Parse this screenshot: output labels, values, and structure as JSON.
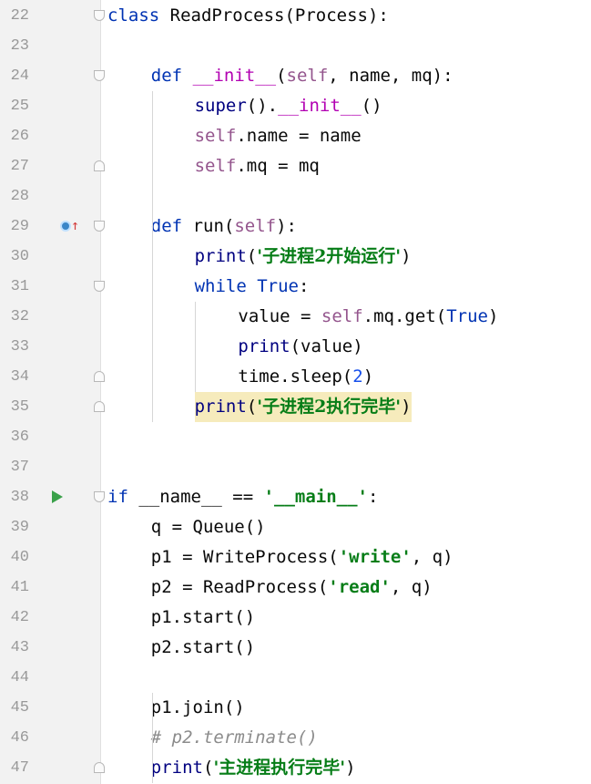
{
  "lines": [
    {
      "n": "22",
      "t": [
        [
          "kw",
          "class"
        ],
        [
          "",
          "ReadProcess(Process):"
        ]
      ]
    },
    {
      "n": "23",
      "t": []
    },
    {
      "n": "24",
      "t": [
        [
          "kw",
          "def"
        ],
        [
          "",
          ""
        ],
        [
          "dunder",
          "__init__"
        ],
        [
          "",
          "("
        ],
        [
          "self",
          "self"
        ],
        [
          "",
          ", name, mq):"
        ]
      ]
    },
    {
      "n": "25",
      "t": [
        [
          "fn",
          "super"
        ],
        [
          "",
          "()."
        ],
        [
          "dunder",
          "__init__"
        ],
        [
          "",
          "()"
        ]
      ]
    },
    {
      "n": "26",
      "t": [
        [
          "self",
          "self"
        ],
        [
          "",
          ".name = name"
        ]
      ]
    },
    {
      "n": "27",
      "t": [
        [
          "self",
          "self"
        ],
        [
          "",
          ".mq = mq"
        ]
      ]
    },
    {
      "n": "28",
      "t": []
    },
    {
      "n": "29",
      "t": [
        [
          "kw",
          "def"
        ],
        [
          "",
          "run("
        ],
        [
          "self",
          "self"
        ],
        [
          "",
          "):"
        ]
      ]
    },
    {
      "n": "30",
      "t": [
        [
          "fn",
          "print"
        ],
        [
          "",
          "("
        ],
        [
          "str",
          "'子进程2开始运行'"
        ],
        [
          "",
          ")"
        ]
      ]
    },
    {
      "n": "31",
      "t": [
        [
          "kw",
          "while"
        ],
        [
          "",
          ""
        ],
        [
          "kw",
          "True"
        ],
        [
          "",
          ":"
        ]
      ]
    },
    {
      "n": "32",
      "t": [
        [
          "",
          "value = "
        ],
        [
          "self",
          "self"
        ],
        [
          "",
          ".mq.get("
        ],
        [
          "kw",
          "True"
        ],
        [
          "",
          ")"
        ]
      ]
    },
    {
      "n": "33",
      "t": [
        [
          "fn",
          "print"
        ],
        [
          "",
          "(value)"
        ]
      ]
    },
    {
      "n": "34",
      "t": [
        [
          "",
          "time.sleep("
        ],
        [
          "num",
          "2"
        ],
        [
          "",
          ")"
        ]
      ]
    },
    {
      "n": "35",
      "t": [
        [
          "fn",
          "print"
        ],
        [
          "",
          "("
        ],
        [
          "str",
          "'子进程2执行完毕'"
        ],
        [
          "",
          ")"
        ]
      ]
    },
    {
      "n": "36",
      "t": []
    },
    {
      "n": "37",
      "t": []
    },
    {
      "n": "38",
      "t": [
        [
          "kw",
          "if"
        ],
        [
          "",
          "__name__ == "
        ],
        [
          "str",
          "'__main__'"
        ],
        [
          "",
          ":"
        ]
      ]
    },
    {
      "n": "39",
      "t": [
        [
          "",
          "q = Queue()"
        ]
      ]
    },
    {
      "n": "40",
      "t": [
        [
          "",
          "p1 = WriteProcess("
        ],
        [
          "str",
          "'write'"
        ],
        [
          "",
          ", q)"
        ]
      ]
    },
    {
      "n": "41",
      "t": [
        [
          "",
          "p2 = ReadProcess("
        ],
        [
          "str",
          "'read'"
        ],
        [
          "",
          ", q)"
        ]
      ]
    },
    {
      "n": "42",
      "t": [
        [
          "",
          "p1.start()"
        ]
      ]
    },
    {
      "n": "43",
      "t": [
        [
          "",
          "p2.start()"
        ]
      ]
    },
    {
      "n": "44",
      "t": []
    },
    {
      "n": "45",
      "t": [
        [
          "",
          "p1.join()"
        ]
      ]
    },
    {
      "n": "46",
      "t": [
        [
          "cmt",
          "# p2.terminate()"
        ]
      ]
    },
    {
      "n": "47",
      "t": [
        [
          "fn",
          "print"
        ],
        [
          "",
          "("
        ],
        [
          "str",
          "'主进程执行完毕'"
        ],
        [
          "",
          ")"
        ]
      ]
    }
  ],
  "colors": {
    "keyword": "#0033b3",
    "function": "#000080",
    "self": "#94558d",
    "dunder": "#b200b2",
    "string": "#067d17",
    "number": "#1750eb",
    "comment": "#8c8c8c",
    "highlight": "#f6ebbc"
  }
}
